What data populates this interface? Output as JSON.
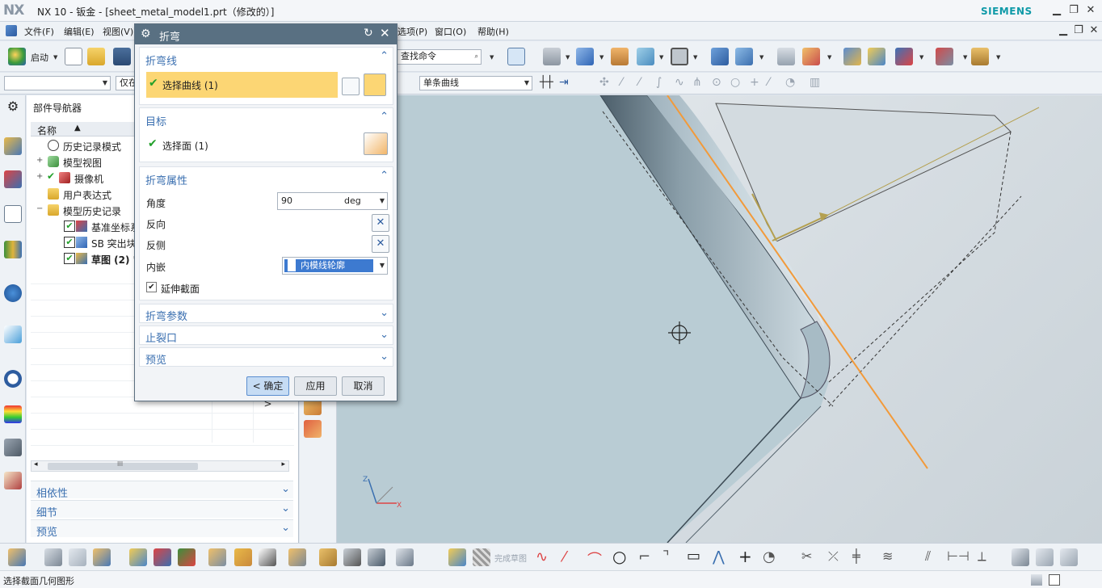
{
  "titlebar": {
    "logo": "NX",
    "title": "NX 10 - 钣金 - [sheet_metal_model1.prt（修改的）]",
    "brand": "SIEMENS",
    "minimize": "▁",
    "restore": "❐",
    "close": "✕"
  },
  "menubar": {
    "items": [
      "文件(F)",
      "编辑(E)",
      "视图(V)",
      "选项(P)",
      "窗口(O)",
      "帮助(H)"
    ],
    "doc_minimize": "▁",
    "doc_restore": "❐",
    "doc_close": "✕"
  },
  "toolbar": {
    "start_label": "启动",
    "command_search_placeholder": "查找命令",
    "filter_combo_value": "",
    "scope_combo_value": "仅在",
    "curve_rule_value": "单条曲线"
  },
  "navigator": {
    "title": "部件导航器",
    "column_name": "名称",
    "sort_icon": "▲",
    "rows": [
      {
        "exp": "",
        "label": "历史记录模式",
        "icon": "clock-icon"
      },
      {
        "exp": "+",
        "label": "模型视图",
        "icon": "model-view-icon"
      },
      {
        "exp": "+",
        "label": "摄像机",
        "icon": "camera-icon"
      },
      {
        "exp": "",
        "label": "用户表达式",
        "icon": "folder-icon"
      },
      {
        "exp": "−",
        "label": "模型历史记录",
        "icon": "folder-icon"
      },
      {
        "exp": "",
        "label": "基准坐标系",
        "icon": "datum-csys-icon"
      },
      {
        "exp": "",
        "label": "SB 突出块",
        "icon": "tab-feature-icon"
      },
      {
        "exp": "",
        "label": "草图 (2) \"",
        "icon": "sketch-icon"
      }
    ],
    "sections": [
      "相依性",
      "细节",
      "预览"
    ],
    "scroll_grip": "III"
  },
  "dialog": {
    "title": "折弯",
    "groups": {
      "bend_line": {
        "title": "折弯线",
        "select_label": "选择曲线 (1)"
      },
      "target": {
        "title": "目标",
        "select_label": "选择面 (1)"
      },
      "bend_props": {
        "title": "折弯属性",
        "angle_label": "角度",
        "angle_value": "90",
        "angle_unit": "deg",
        "reverse_label": "反向",
        "reverse_side_label": "反侧",
        "inset_label": "内嵌",
        "inset_value": "内模线轮廓",
        "extend_label": "延伸截面",
        "extend_checked": true
      },
      "bend_params": {
        "title": "折弯参数"
      },
      "relief": {
        "title": "止裂口"
      },
      "preview": {
        "title": "预览"
      }
    },
    "buttons": {
      "ok": "< 确定 >",
      "apply": "应用",
      "cancel": "取消"
    }
  },
  "bottombar": {
    "finish_sketch_label": "完成草图"
  },
  "status": {
    "text": "选择截面几何图形"
  },
  "colors": {
    "accent": "#597082",
    "highlight": "#fcd674",
    "bend_line": "#f29a3a",
    "link": "#3a6fb0"
  }
}
